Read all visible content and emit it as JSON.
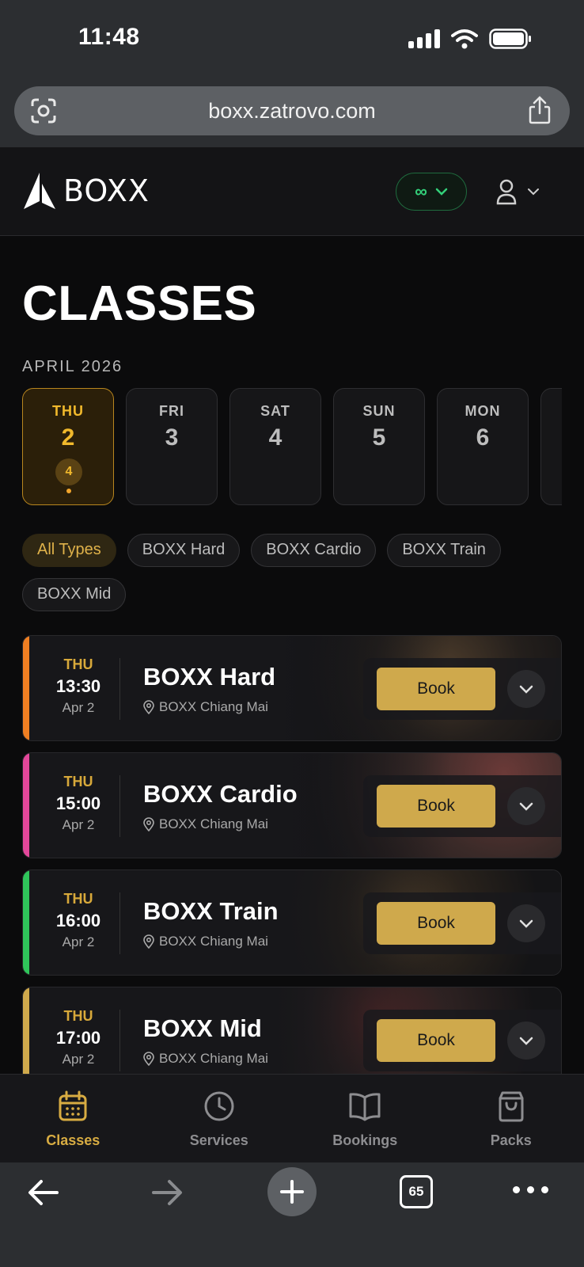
{
  "status_bar": {
    "time": "11:48"
  },
  "browser": {
    "url": "boxx.zatrovo.com",
    "tab_count": "65"
  },
  "header": {
    "logo_text": "BOXX",
    "credits": "∞"
  },
  "page": {
    "title": "CLASSES",
    "month": "APRIL 2026"
  },
  "days": [
    {
      "dow": "THU",
      "num": "2",
      "count": "4",
      "active": true
    },
    {
      "dow": "FRI",
      "num": "3"
    },
    {
      "dow": "SAT",
      "num": "4"
    },
    {
      "dow": "SUN",
      "num": "5"
    },
    {
      "dow": "MON",
      "num": "6"
    }
  ],
  "filters": [
    "All Types",
    "BOXX Hard",
    "BOXX Cardio",
    "BOXX Train",
    "BOXX Mid"
  ],
  "classes": [
    {
      "dow": "THU",
      "time": "13:30",
      "date": "Apr 2",
      "name": "BOXX Hard",
      "location": "BOXX Chiang Mai",
      "book_label": "Book",
      "accent": "#f07f22"
    },
    {
      "dow": "THU",
      "time": "15:00",
      "date": "Apr 2",
      "name": "BOXX Cardio",
      "location": "BOXX Chiang Mai",
      "book_label": "Book",
      "accent": "#e3479a"
    },
    {
      "dow": "THU",
      "time": "16:00",
      "date": "Apr 2",
      "name": "BOXX Train",
      "location": "BOXX Chiang Mai",
      "book_label": "Book",
      "accent": "#2fc55a"
    },
    {
      "dow": "THU",
      "time": "17:00",
      "date": "Apr 2",
      "name": "BOXX Mid",
      "location": "BOXX Chiang Mai",
      "book_label": "Book",
      "accent": "#cfa94c"
    }
  ],
  "bottom_nav": [
    {
      "label": "Classes",
      "icon": "calendar-icon",
      "active": true
    },
    {
      "label": "Services",
      "icon": "clock-icon"
    },
    {
      "label": "Bookings",
      "icon": "book-icon"
    },
    {
      "label": "Packs",
      "icon": "shopping-bag-icon"
    }
  ],
  "colors": {
    "accent_gold": "#d8ac42",
    "background": "#0b0b0c",
    "credits_green": "#33d07a"
  }
}
